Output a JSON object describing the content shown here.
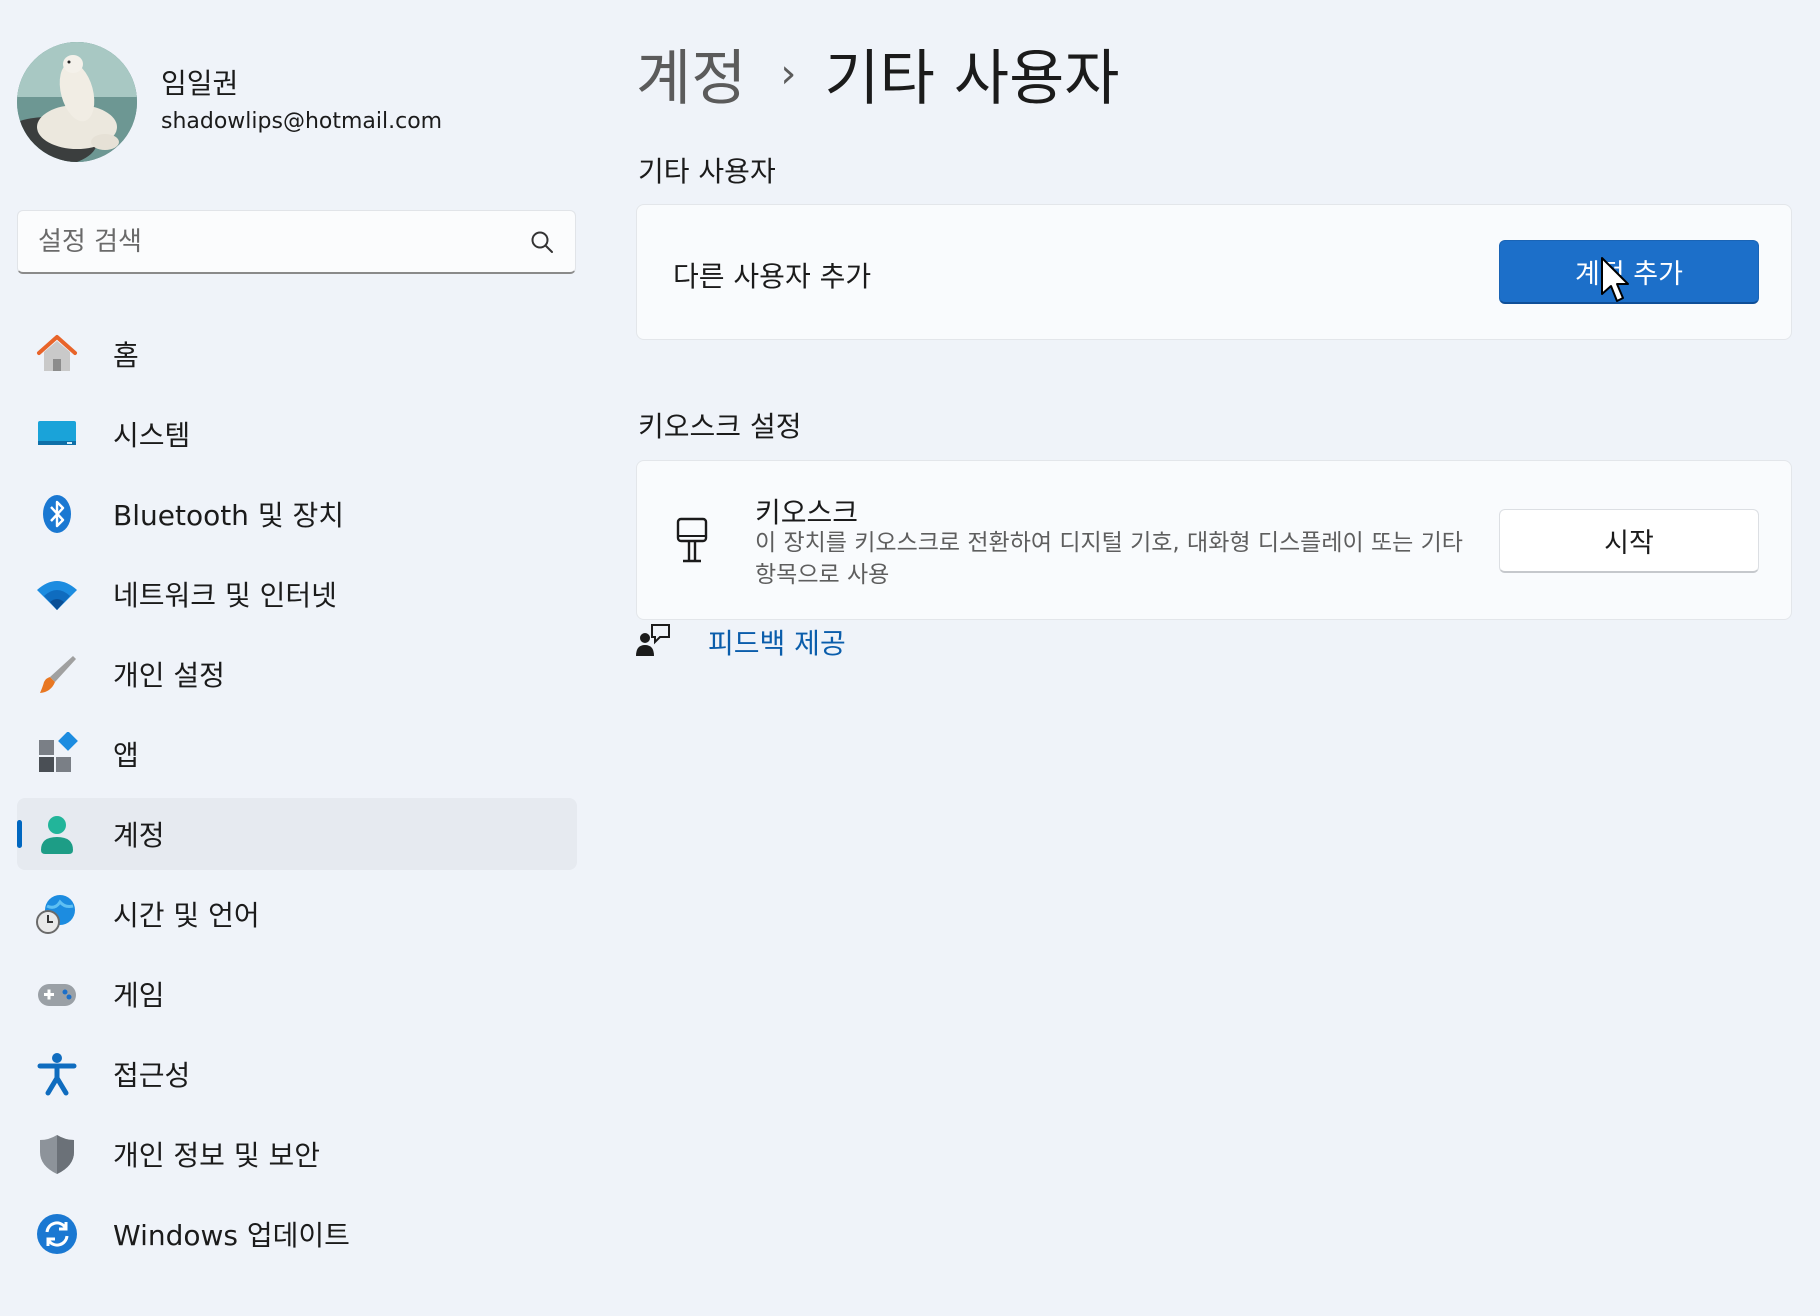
{
  "profile": {
    "name": "임일권",
    "email": "shadowlips@hotmail.com"
  },
  "search": {
    "placeholder": "설정 검색"
  },
  "nav": {
    "items": [
      {
        "label": "홈",
        "icon": "home-icon"
      },
      {
        "label": "시스템",
        "icon": "system-icon"
      },
      {
        "label": "Bluetooth 및 장치",
        "icon": "bluetooth-icon"
      },
      {
        "label": "네트워크 및 인터넷",
        "icon": "wifi-icon"
      },
      {
        "label": "개인 설정",
        "icon": "brush-icon"
      },
      {
        "label": "앱",
        "icon": "apps-icon"
      },
      {
        "label": "계정",
        "icon": "account-icon",
        "active": true
      },
      {
        "label": "시간 및 언어",
        "icon": "time-language-icon"
      },
      {
        "label": "게임",
        "icon": "gamepad-icon"
      },
      {
        "label": "접근성",
        "icon": "accessibility-icon"
      },
      {
        "label": "개인 정보 및 보안",
        "icon": "shield-icon"
      },
      {
        "label": "Windows 업데이트",
        "icon": "update-icon"
      }
    ]
  },
  "breadcrumb": {
    "parent": "계정",
    "separator": "›",
    "current": "기타 사용자"
  },
  "other_users": {
    "section_title": "기타 사용자",
    "add_user_text": "다른 사용자 추가",
    "add_account_button": "계정 추가"
  },
  "kiosk": {
    "section_title": "키오스크 설정",
    "title": "키오스크",
    "description": "이 장치를 키오스크로 전환하여 디지털 기호, 대화형 디스플레이 또는 기타 항목으로 사용",
    "start_button": "시작"
  },
  "feedback": {
    "label": "피드백 제공"
  },
  "colors": {
    "accent": "#0067c0",
    "primary_button": "#1c6fc9",
    "link": "#0a5dab",
    "background": "#eff3f9"
  }
}
